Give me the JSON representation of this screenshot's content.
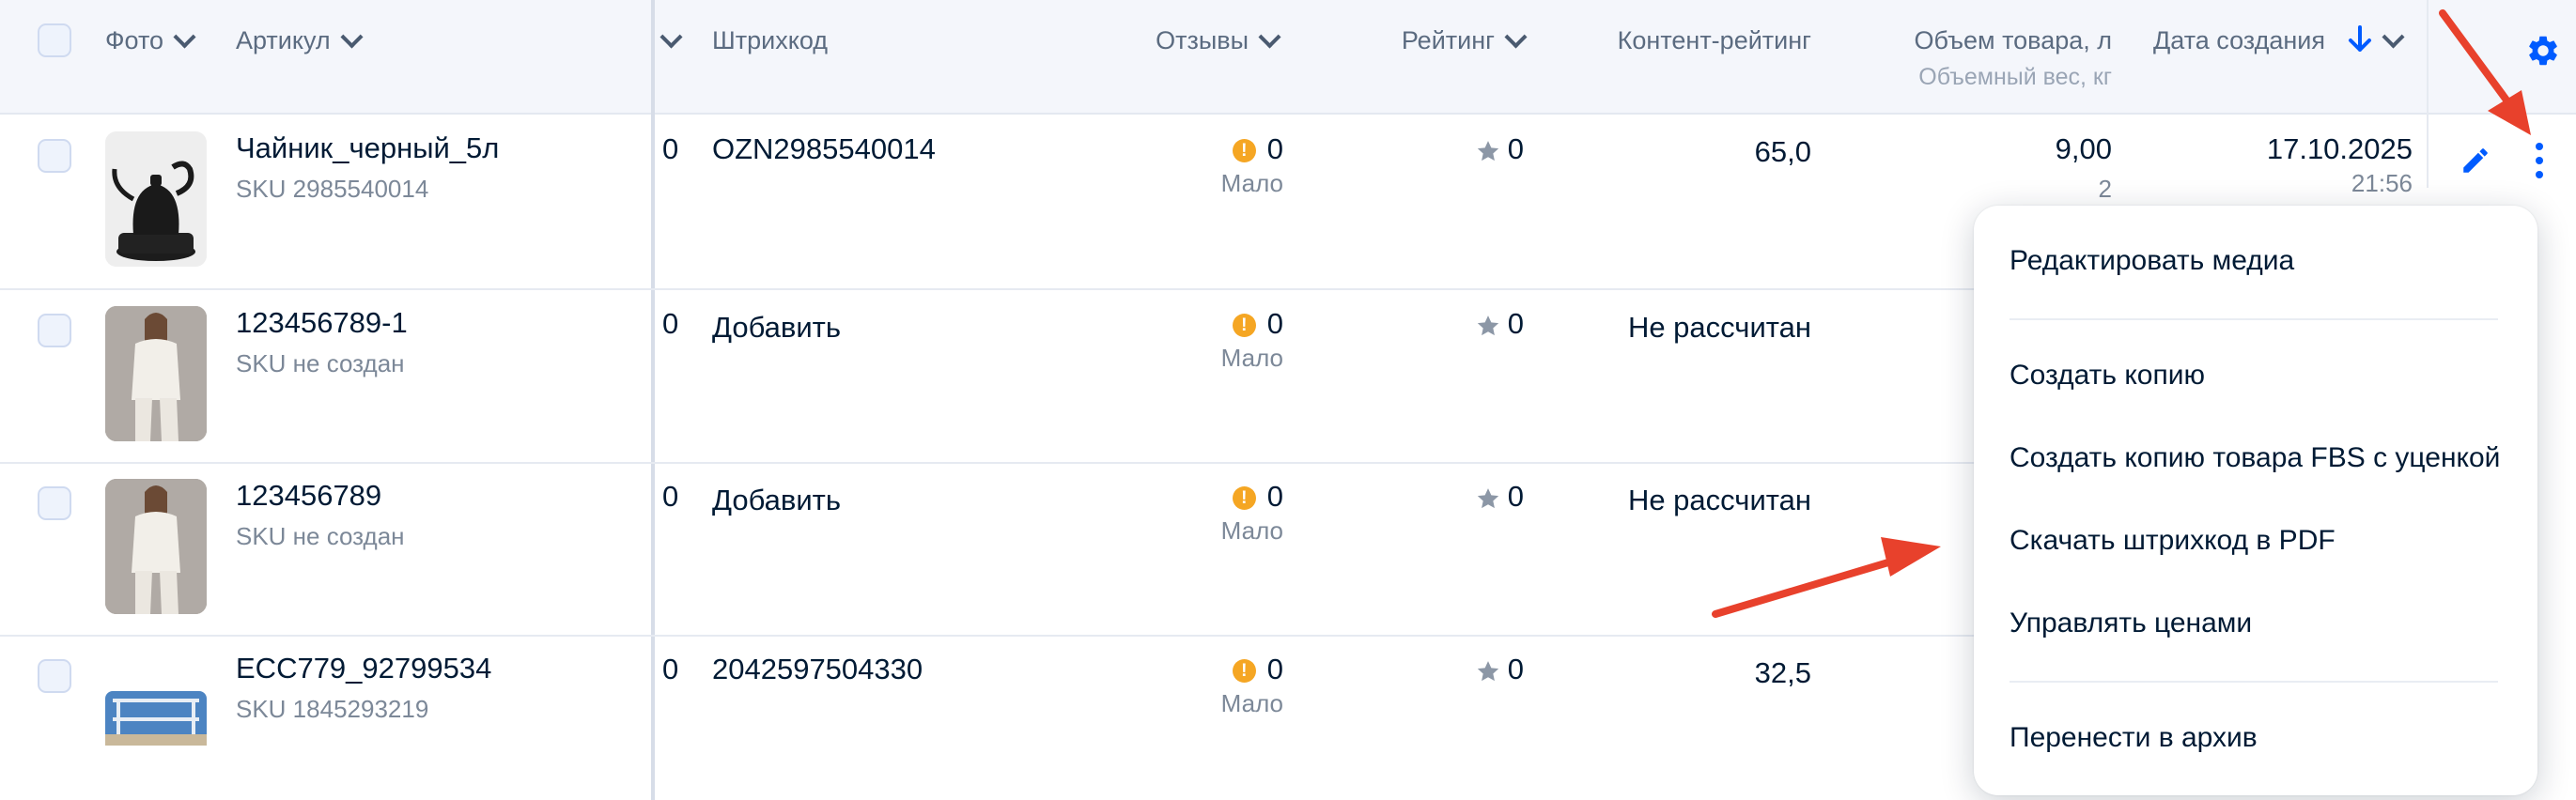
{
  "header": {
    "photo": "Фото",
    "article": "Артикул",
    "barcode": "Штрихкод",
    "reviews": "Отзывы",
    "rating": "Рейтинг",
    "content_rating": "Контент-рейтинг",
    "volume": "Объем товара, л",
    "volume_sub": "Объемный вес, кг",
    "created": "Дата создания"
  },
  "rows": [
    {
      "name": "Чайник_черный_5л",
      "sku": "SKU 2985540014",
      "col0": "0",
      "barcode": "OZN2985540014",
      "reviews": "0",
      "reviews_sub": "Мало",
      "rating": "0",
      "content_rating": "65,0",
      "volume": "9,00",
      "volume_sub": "2",
      "date": "17.10.2025",
      "time": "21:56"
    },
    {
      "name": "123456789-1",
      "sku": "SKU не создан",
      "col0": "0",
      "barcode": "Добавить",
      "reviews": "0",
      "reviews_sub": "Мало",
      "rating": "0",
      "content_rating": "Не рассчитан"
    },
    {
      "name": "123456789",
      "sku": "SKU не создан",
      "col0": "0",
      "barcode": "Добавить",
      "reviews": "0",
      "reviews_sub": "Мало",
      "rating": "0",
      "content_rating": "Не рассчитан"
    },
    {
      "name": "ECC779_92799534",
      "sku": "SKU 1845293219",
      "col0": "0",
      "barcode": "2042597504330",
      "reviews": "0",
      "reviews_sub": "Мало",
      "rating": "0",
      "content_rating": "32,5"
    }
  ],
  "menu": {
    "items": [
      "Редактировать медиа",
      "Создать копию",
      "Создать копию товара FBS с уценкой",
      "Скачать штрихкод в PDF",
      "Управлять ценами",
      "Перенести в архив"
    ]
  },
  "icons": {
    "settings": "gear-icon",
    "edit": "pencil-icon",
    "more": "more-vertical-icon",
    "warning": "warning-icon",
    "star": "star-icon",
    "sort": "arrow-down-icon",
    "annotation": "red-arrow"
  },
  "colors": {
    "accent": "#005bff",
    "warning": "#f5a623",
    "annotation_arrow": "#e8412c",
    "header_bg": "#f4f6fb"
  }
}
